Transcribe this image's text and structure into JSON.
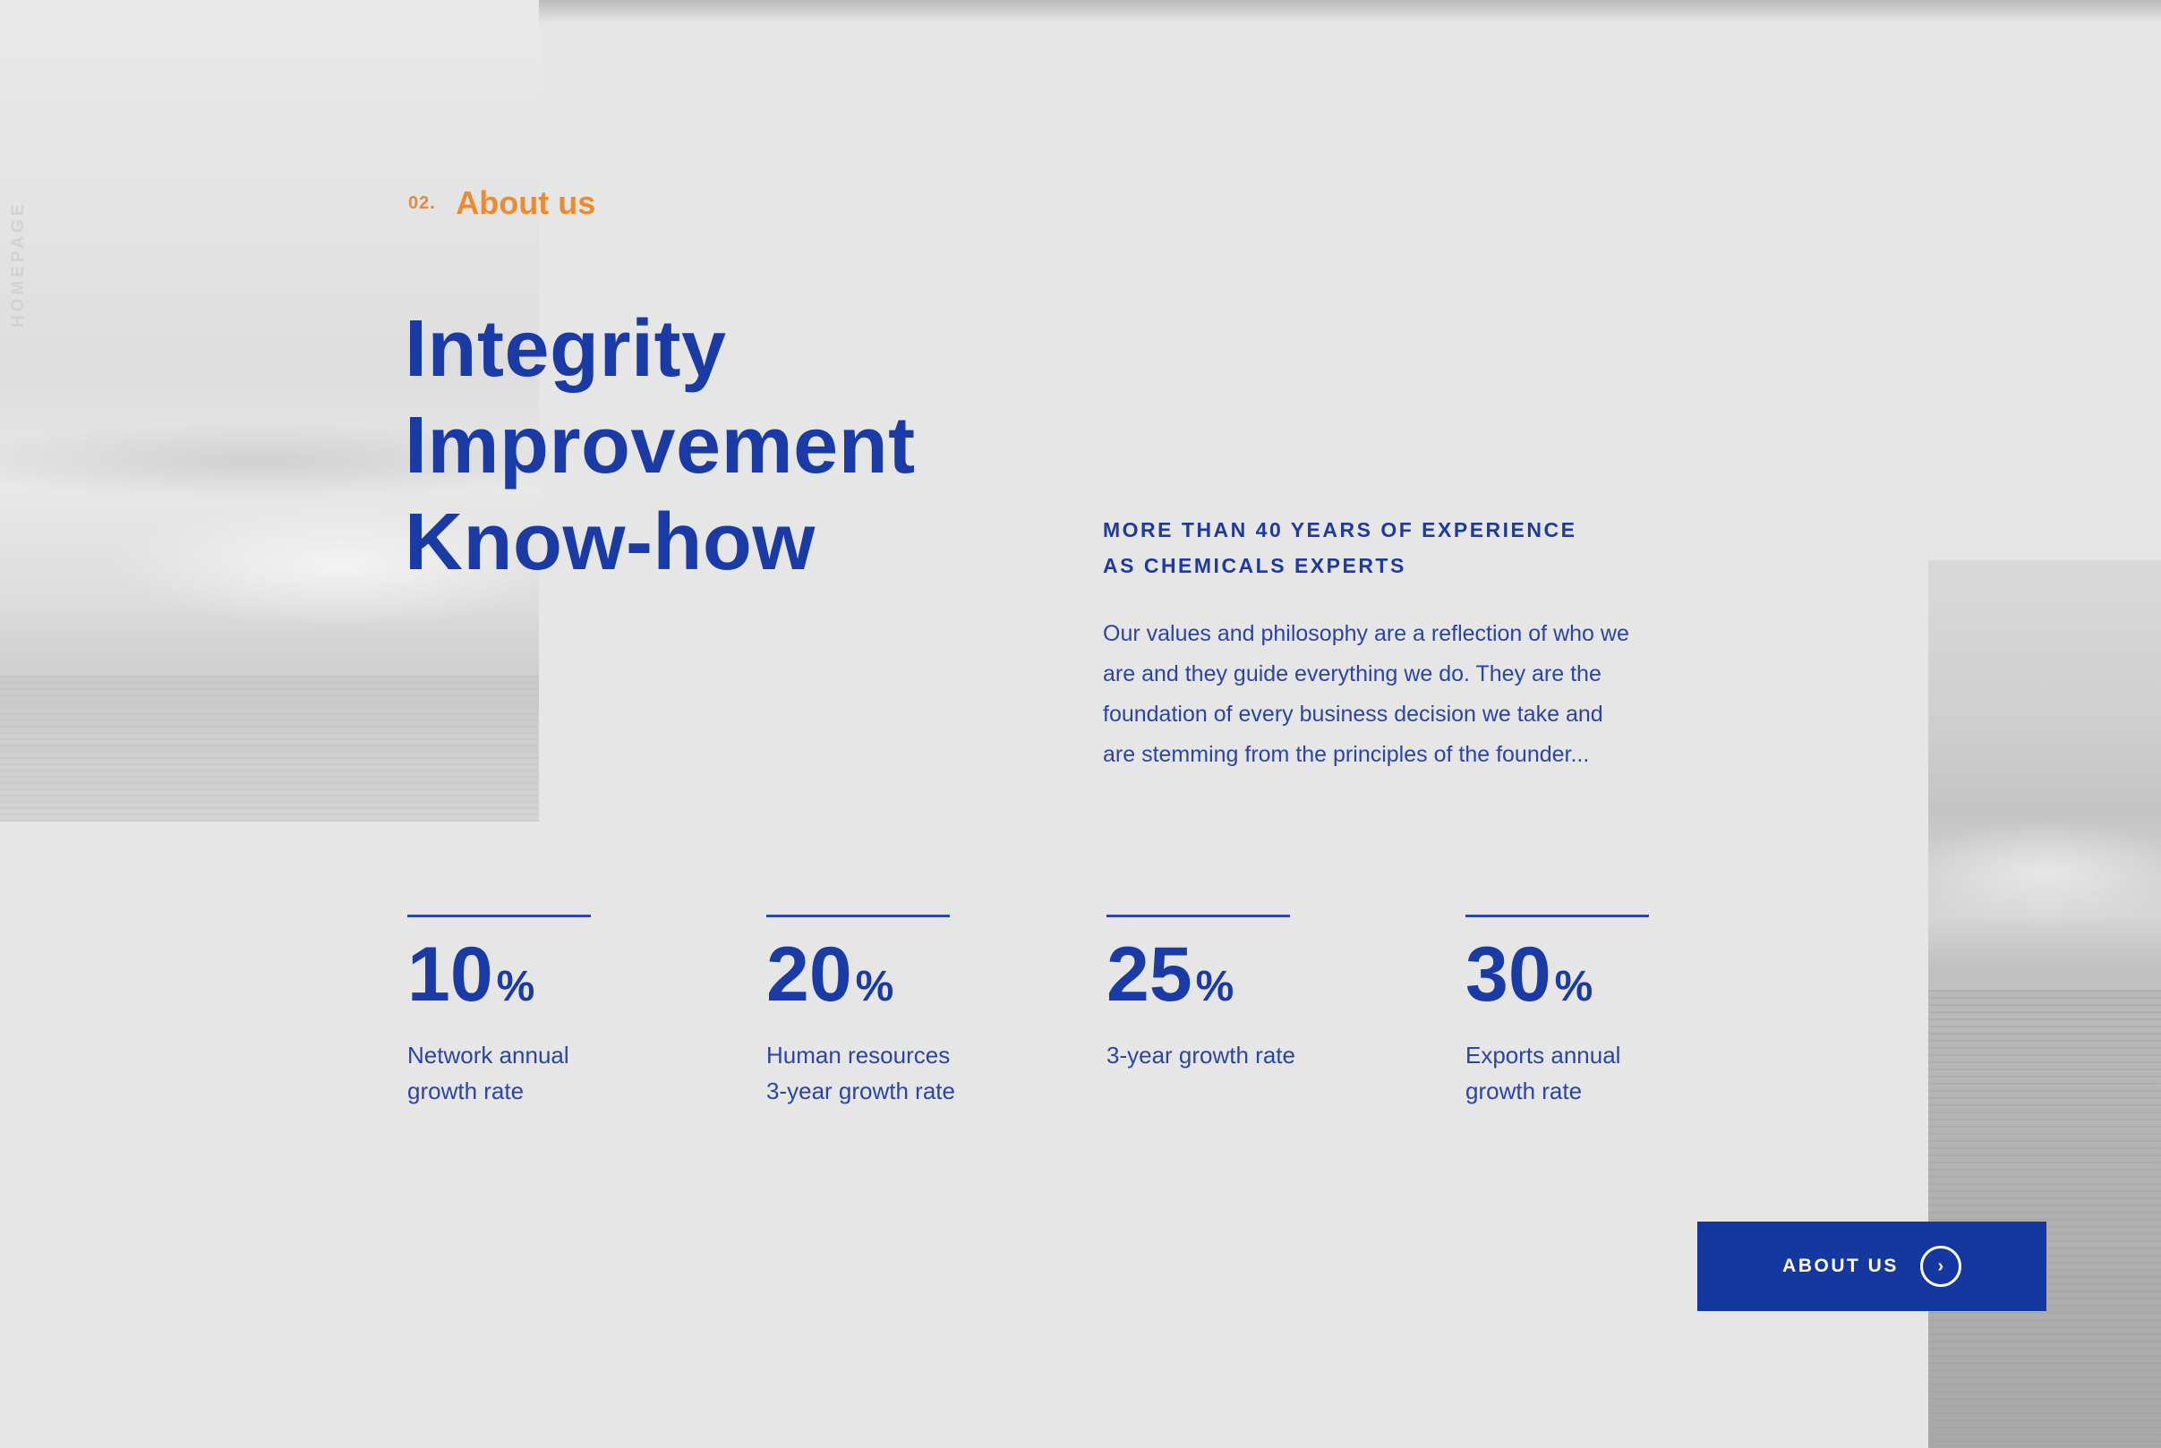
{
  "sidebar": {
    "vertical_label": "HOMEPAGE"
  },
  "section": {
    "number": "02.",
    "title": "About us"
  },
  "headline": {
    "lines": [
      "Integrity",
      "Improvement",
      "Know-how"
    ]
  },
  "experience": {
    "title_line1": "MORE THAN 40 YEARS OF EXPERIENCE",
    "title_line2": "AS CHEMICALS EXPERTS",
    "body": "Our values and philosophy are a reflection of who we are and they guide everything we do. They are the foundation of every business decision we take and are stemming from the principles of the founder..."
  },
  "stats": [
    {
      "value": "10",
      "unit": "%",
      "label_line1": "Network annual",
      "label_line2": "growth rate"
    },
    {
      "value": "20",
      "unit": "%",
      "label_line1": "Human resources",
      "label_line2": "3-year growth rate"
    },
    {
      "value": "25",
      "unit": "%",
      "label_line1": "3-year growth rate",
      "label_line2": ""
    },
    {
      "value": "30",
      "unit": "%",
      "label_line1": "Exports annual",
      "label_line2": "growth rate"
    }
  ],
  "cta": {
    "label": "ABOUT US",
    "icon": "chevron-right-circle-icon"
  },
  "colors": {
    "primary": "#1a3aa6",
    "accent": "#ec8a32",
    "background": "#e6e6e6",
    "button": "#1537a0"
  }
}
